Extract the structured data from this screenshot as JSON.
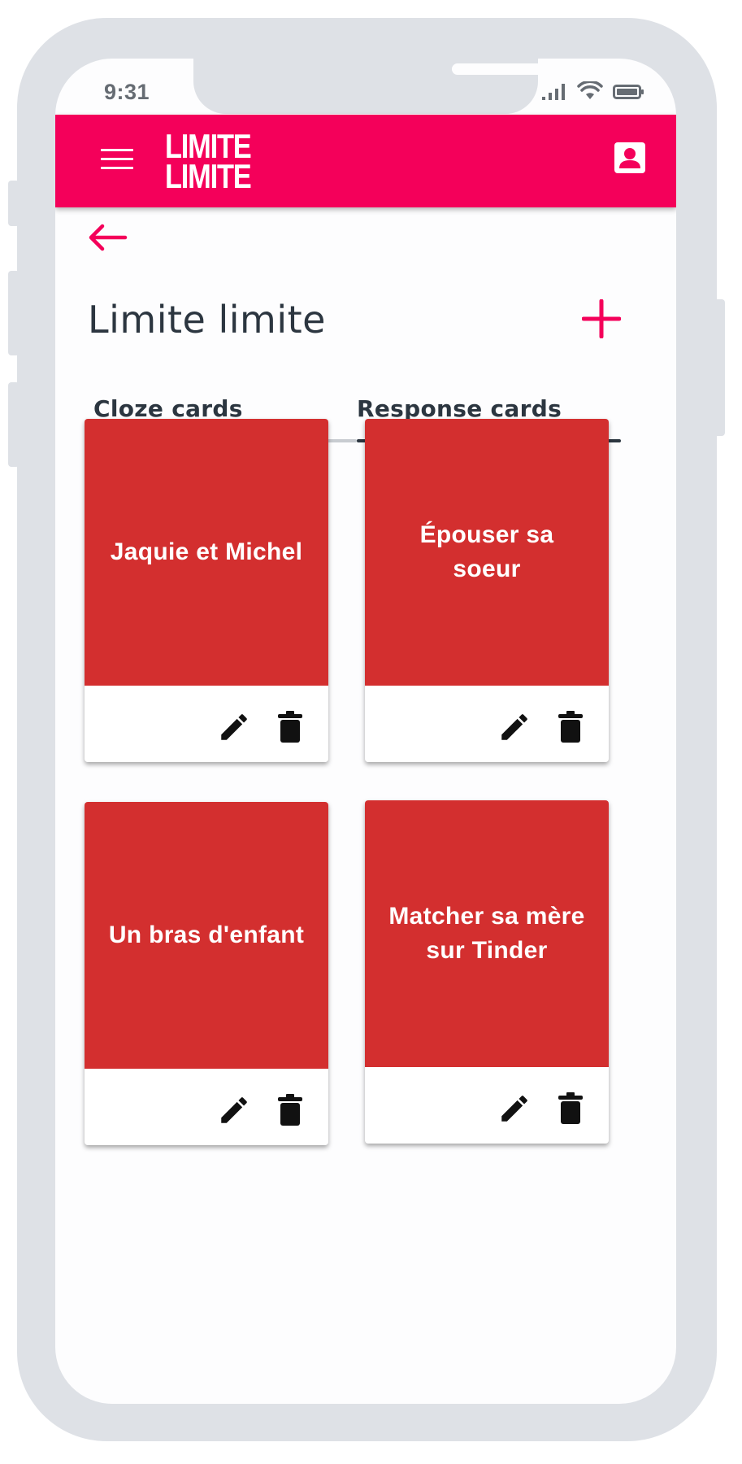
{
  "status_bar": {
    "time": "9:31"
  },
  "app_bar": {
    "brand": "LIMITE LIMITE",
    "brand_lines": [
      "LIMITE",
      "LIMITE"
    ],
    "color": "#f4005a"
  },
  "page": {
    "title": "Limite limite"
  },
  "tabs": [
    {
      "label": "Cloze cards",
      "selected": false
    },
    {
      "label": "Response cards",
      "selected": true
    }
  ],
  "cards": [
    {
      "text": "Jaquie et Michel"
    },
    {
      "text": "Épouser sa soeur"
    },
    {
      "text": "Un bras d'enfant"
    },
    {
      "text": "Matcher sa mère sur Tinder"
    }
  ],
  "colors": {
    "card": "#d32f2f",
    "text_dark": "#2c3640",
    "frame": "#dee1e6"
  },
  "icons": [
    "menu-icon",
    "account-icon",
    "arrow-back-icon",
    "plus-icon",
    "pencil-icon",
    "trash-icon",
    "signal-icon",
    "wifi-icon",
    "battery-icon"
  ]
}
